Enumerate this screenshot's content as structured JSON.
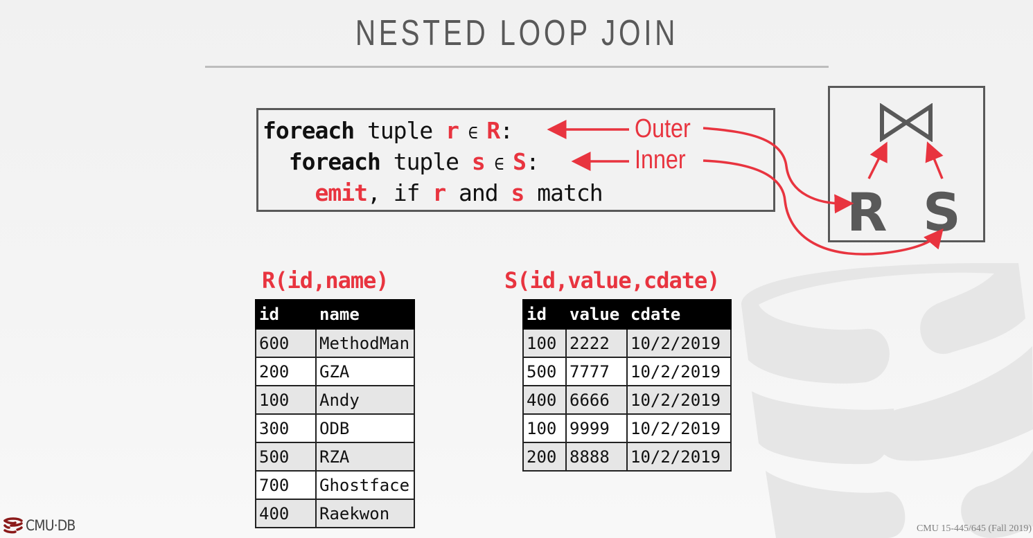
{
  "slide": {
    "title": "NESTED LOOP JOIN",
    "accent_color": "#e8343f",
    "text_color": "#595959"
  },
  "code": {
    "line1": {
      "kw": "foreach",
      "t1": " tuple ",
      "var": "r",
      "elem": " ∈ ",
      "rel": "R",
      "colon": ":"
    },
    "line2": {
      "indent": "  ",
      "kw": "foreach",
      "t1": " tuple ",
      "var": "s",
      "elem": " ∈ ",
      "rel": "S",
      "colon": ":"
    },
    "line3": {
      "indent": "    ",
      "kw": "emit",
      "t1": ", if ",
      "var1": "r",
      "t2": " and ",
      "var2": "s",
      "t3": " match"
    }
  },
  "annotations": {
    "outer": "Outer",
    "inner": "Inner"
  },
  "plan": {
    "join_icon": "bowtie-join-icon",
    "left": "R",
    "right": "S"
  },
  "tables": {
    "R": {
      "title": "R(id,name)",
      "columns": [
        "id",
        "name"
      ],
      "rows": [
        [
          "600",
          "MethodMan"
        ],
        [
          "200",
          "GZA"
        ],
        [
          "100",
          "Andy"
        ],
        [
          "300",
          "ODB"
        ],
        [
          "500",
          "RZA"
        ],
        [
          "700",
          "Ghostface"
        ],
        [
          "400",
          "Raekwon"
        ]
      ]
    },
    "S": {
      "title": "S(id,value,cdate)",
      "columns": [
        "id",
        "value",
        "cdate"
      ],
      "rows": [
        [
          "100",
          "2222",
          "10/2/2019"
        ],
        [
          "500",
          "7777",
          "10/2/2019"
        ],
        [
          "400",
          "6666",
          "10/2/2019"
        ],
        [
          "100",
          "9999",
          "10/2/2019"
        ],
        [
          "200",
          "8888",
          "10/2/2019"
        ]
      ]
    }
  },
  "footer": {
    "logo_text": "CMU·DB",
    "course": "CMU 15-445/645 (Fall 2019)"
  }
}
